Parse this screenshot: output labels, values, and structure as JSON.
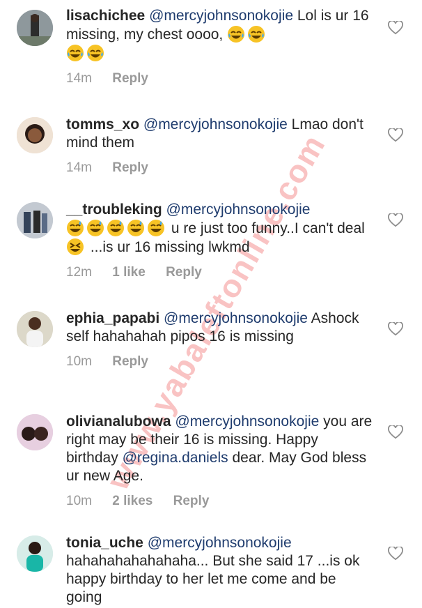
{
  "watermark": "www.yabaleftonline.com",
  "comments": [
    {
      "username": "lisachichee",
      "mention": "@mercyjohnsonokojie",
      "text": "Lol is ur 16 missing, my chest oooo,",
      "emojis_inline": [
        "tears-of-joy-emoji",
        "tears-of-joy-emoji"
      ],
      "emojis_next_line": [
        "tears-of-joy-emoji",
        "tears-of-joy-emoji"
      ],
      "time": "14m",
      "likes": "",
      "reply": "Reply"
    },
    {
      "username": "tomms_xo",
      "mention": "@mercyjohnsonokojie",
      "text": "Lmao don't mind them",
      "time": "14m",
      "likes": "",
      "reply": "Reply"
    },
    {
      "username": "__troubleking",
      "mention": "@mercyjohnsonokojie",
      "text_before_emojis": "",
      "emojis": [
        "grinning-sweat-emoji",
        "grinning-sweat-emoji",
        "grinning-sweat-emoji",
        "grinning-sweat-emoji",
        "grinning-sweat-emoji"
      ],
      "text_after_emojis": "u re just too funny..I can't deal",
      "emoji_mid": "laughing-emoji",
      "text_end": "...is ur 16 missing lwkmd",
      "time": "12m",
      "likes": "1 like",
      "reply": "Reply"
    },
    {
      "username": "ephia_papabi",
      "mention": "@mercyjohnsonokojie",
      "text": "Ashock self hahahahah pipos 16 is missing",
      "time": "10m",
      "likes": "",
      "reply": "Reply"
    },
    {
      "username": "olivianalubowa",
      "mention": "@mercyjohnsonokojie",
      "text": "you are right may be their 16 is missing. Happy birthday",
      "mention2": "@regina.daniels",
      "text2": "dear. May God bless ur new Age.",
      "time": "10m",
      "likes": "2 likes",
      "reply": "Reply"
    },
    {
      "username": "tonia_uche",
      "mention": "@mercyjohnsonokojie",
      "text": "hahahahahahahaha... But she said 17 ...is ok happy birthday to her let me come and be going",
      "time": "",
      "likes": "",
      "reply": ""
    }
  ]
}
